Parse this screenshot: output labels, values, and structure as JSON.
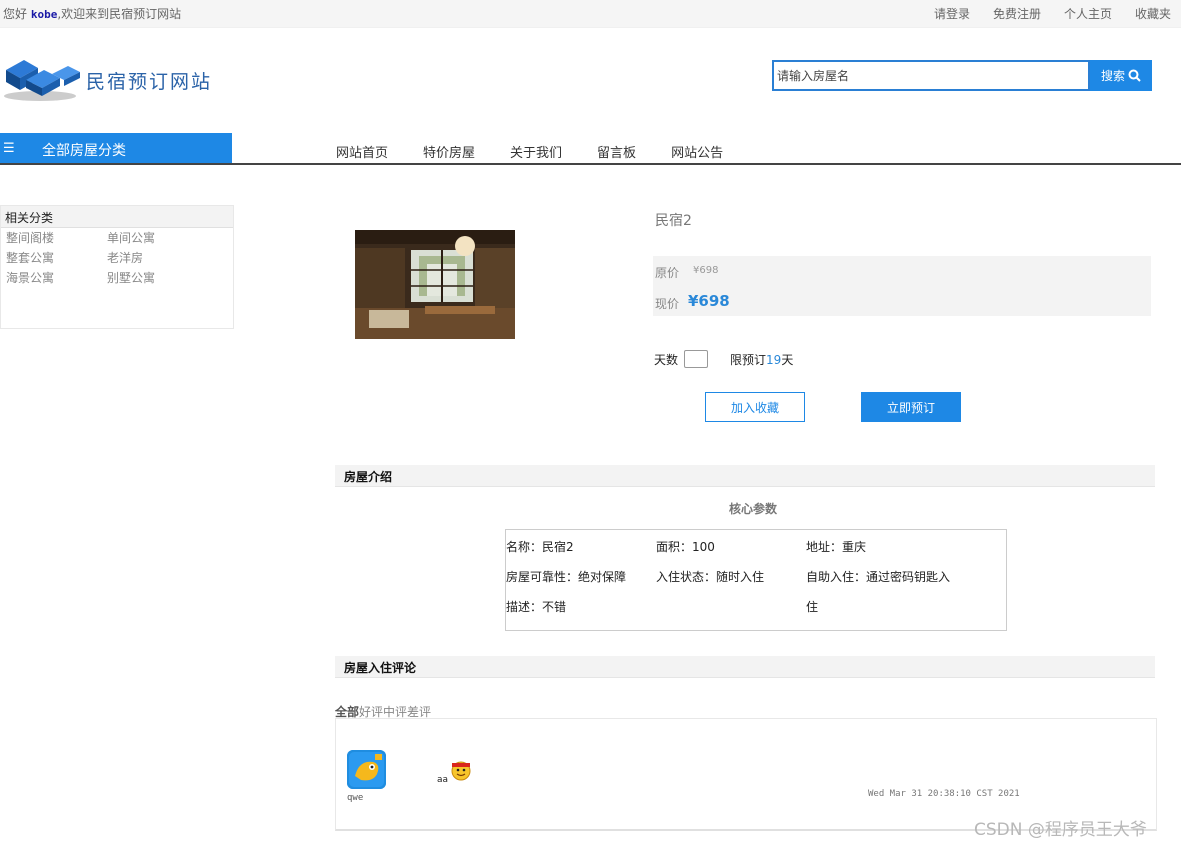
{
  "topbar": {
    "greeting_prefix": "您好",
    "username": "kobe",
    "greeting_suffix": ",欢迎来到民宿预订网站",
    "links": [
      "请登录",
      "免费注册",
      "个人主页",
      "收藏夹"
    ]
  },
  "logo": {
    "text": "民宿预订网站"
  },
  "search": {
    "placeholder": "请输入房屋名",
    "button_label": "搜索"
  },
  "category_header": {
    "label": "全部房屋分类"
  },
  "nav": {
    "items": [
      "网站首页",
      "特价房屋",
      "关于我们",
      "留言板",
      "网站公告"
    ]
  },
  "sidebar": {
    "title": "相关分类",
    "items": [
      "整间阁楼",
      "单间公寓",
      "整套公寓",
      "老洋房",
      "海景公寓",
      "别墅公寓"
    ]
  },
  "product": {
    "name": "民宿2",
    "original_price_label": "原价",
    "original_price": "¥698",
    "current_price_label": "现价",
    "current_price": "¥698",
    "days_label": "天数",
    "limit_prefix": "限预订",
    "limit_days": "19",
    "limit_suffix": "天",
    "favorite_button": "加入收藏",
    "book_button": "立即预订"
  },
  "intro": {
    "section_title": "房屋介绍",
    "core_title": "核心参数",
    "params": [
      "名称：民宿2",
      "面积：100",
      "地址：重庆",
      "房屋可靠性：绝对保障",
      "入住状态：随时入住",
      "自助入住：通过密码钥匙入",
      "描述：不错",
      "住"
    ]
  },
  "reviews": {
    "section_title": "房屋入住评论",
    "tabs": [
      "全部",
      "好评",
      "中评",
      "差评"
    ],
    "items": [
      {
        "user": "qwe",
        "text": "aa",
        "date": "Wed Mar 31 20:38:10 CST 2021"
      }
    ]
  },
  "watermark": "CSDN @程序员王大爷",
  "colors": {
    "accent": "#1e88e5",
    "price": "#2a88d8"
  }
}
